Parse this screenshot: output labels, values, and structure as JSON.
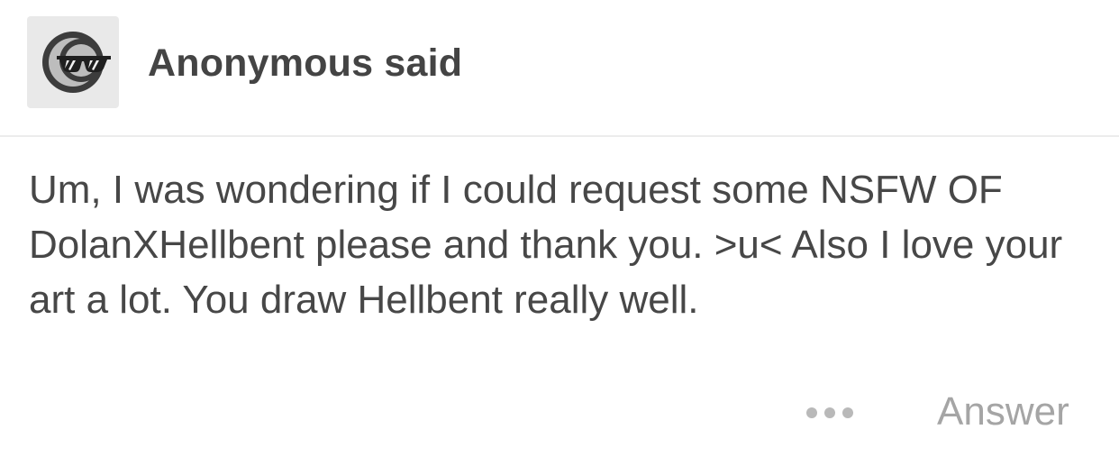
{
  "ask": {
    "asker_name": "Anonymous said",
    "avatar_icon": "anonymous-sunglasses-icon",
    "question_text": "Um, I was wondering if I could request some NSFW OF DolanXHellbent please and thank you. >u< Also I love your art a lot. You draw Hellbent really well.",
    "more_icon": "ellipsis-icon",
    "answer_label": "Answer"
  },
  "colors": {
    "text_primary": "#444444",
    "text_muted": "#a5a5a5",
    "avatar_bg": "#e9e9e9",
    "divider": "#ececec"
  }
}
